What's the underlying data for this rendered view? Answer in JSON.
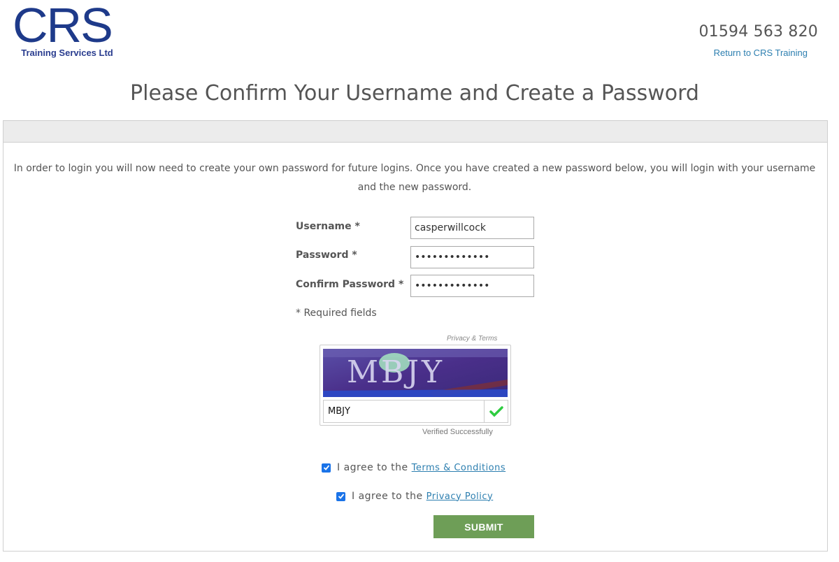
{
  "header": {
    "logo_text": "CRS",
    "logo_subtitle": "Training Services Ltd",
    "phone": "01594 563 820",
    "return_link": "Return to CRS Training"
  },
  "page": {
    "title": "Please Confirm Your Username and Create a Password",
    "intro": "In order to login you will now need to create your own password for future logins. Once you have created a new password below, you will login with your username and the new password."
  },
  "form": {
    "username_label": "Username *",
    "username_value": "casperwillcock",
    "password_label": "Password *",
    "password_value": "•••••••••••••",
    "confirm_label": "Confirm Password *",
    "confirm_value": "•••••••••••••",
    "required_note": "* Required fields"
  },
  "captcha": {
    "privacy_terms": "Privacy & Terms",
    "image_text": "MBJY",
    "input_value": "MBJY",
    "status": "Verified Successfully"
  },
  "agreements": {
    "terms_prefix": "I agree to the",
    "terms_link": "Terms & Conditions",
    "privacy_prefix": "I agree to the",
    "privacy_link": "Privacy Policy",
    "terms_checked": true,
    "privacy_checked": true
  },
  "submit_label": "SUBMIT",
  "colors": {
    "brand_blue": "#1e3a8a",
    "link": "#2d7fb0",
    "submit": "#6e9e57",
    "checkbox": "#1a73e8"
  }
}
